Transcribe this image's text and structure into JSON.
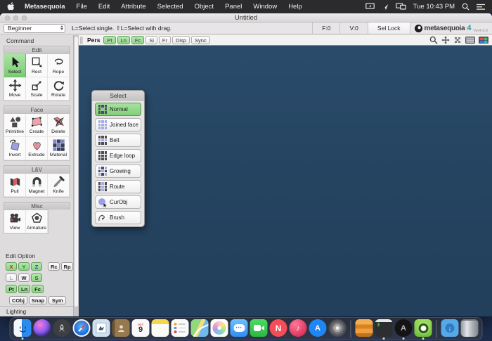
{
  "menubar": {
    "app": "Metasequoia",
    "items": [
      "File",
      "Edit",
      "Attribute",
      "Selected",
      "Object",
      "Panel",
      "Window",
      "Help"
    ],
    "time": "Tue 10:43 PM"
  },
  "window": {
    "title": "Untitled"
  },
  "toolbar": {
    "mode": "Beginner",
    "status": "L=Select single.  ⇧L=Select with drag.",
    "face_count": "F:0",
    "vertex_count": "V:0",
    "sel_lock": "Sel Lock",
    "logo_text": "metasequoia",
    "logo_num": "4",
    "version": "Ver4.6.8"
  },
  "viewrow": {
    "label": "Pers",
    "buttons": [
      {
        "label": "Pt",
        "active": true
      },
      {
        "label": "Ln",
        "active": true
      },
      {
        "label": "Fc",
        "active": true
      },
      {
        "label": "Si",
        "active": false
      },
      {
        "label": "Fr",
        "active": false
      },
      {
        "label": "Disp",
        "active": false
      },
      {
        "label": "Sync",
        "active": false
      }
    ]
  },
  "command_panel": {
    "title": "Command",
    "sections": [
      {
        "title": "Edit",
        "tools": [
          {
            "label": "Select",
            "selected": true
          },
          {
            "label": "Rect"
          },
          {
            "label": "Rope"
          },
          {
            "label": "Move"
          },
          {
            "label": "Scale"
          },
          {
            "label": "Rotate"
          }
        ]
      },
      {
        "title": "Face",
        "tools": [
          {
            "label": "Primitive"
          },
          {
            "label": "Create"
          },
          {
            "label": "Delete"
          },
          {
            "label": "Invert"
          },
          {
            "label": "Extrude"
          },
          {
            "label": "Material"
          }
        ]
      },
      {
        "title": "L&V",
        "tools": [
          {
            "label": "Pull"
          },
          {
            "label": "Magnet"
          },
          {
            "label": "Knife"
          }
        ]
      },
      {
        "title": "Misc",
        "tools": [
          {
            "label": "View"
          },
          {
            "label": "Armature"
          }
        ]
      }
    ],
    "edit_option": {
      "label": "Edit Option",
      "buttons": [
        {
          "label": "X"
        },
        {
          "label": "Y"
        },
        {
          "label": "Z"
        },
        {
          "label": "Rc"
        },
        {
          "label": "Rp"
        },
        {
          "label": "L"
        },
        {
          "label": "W"
        },
        {
          "label": "S"
        },
        {
          "label": "Pt"
        },
        {
          "label": "Ln"
        },
        {
          "label": "Fc"
        },
        {
          "label": "CObj"
        },
        {
          "label": "Snap"
        },
        {
          "label": "Sym"
        }
      ]
    },
    "lighting": "Lighting"
  },
  "select_panel": {
    "title": "Select",
    "items": [
      {
        "label": "Normal",
        "selected": true
      },
      {
        "label": "Joined face"
      },
      {
        "label": "Belt"
      },
      {
        "label": "Edge loop"
      },
      {
        "label": "Growing"
      },
      {
        "label": "Route"
      },
      {
        "label": "CurObj"
      },
      {
        "label": "Brush"
      }
    ]
  },
  "dock": {
    "calendar_date": "9",
    "terminal_prompt": "$",
    "apps": [
      "finder",
      "siri",
      "launchpad",
      "safari",
      "mail",
      "contacts",
      "calendar",
      "notes",
      "reminders",
      "maps",
      "photos",
      "messages",
      "facetime",
      "news",
      "itunes",
      "app-store",
      "system-preferences",
      "toolbox",
      "terminal",
      "audio-app",
      "metasequoia",
      "downloads",
      "trash"
    ],
    "running": [
      "finder",
      "terminal",
      "audio-app",
      "metasequoia"
    ]
  },
  "colors": {
    "viewport": "#254562",
    "active_green": "#9ddb95",
    "selected_tool_green": "#8fd98a",
    "menubar_bg": "#2b2b2d"
  }
}
